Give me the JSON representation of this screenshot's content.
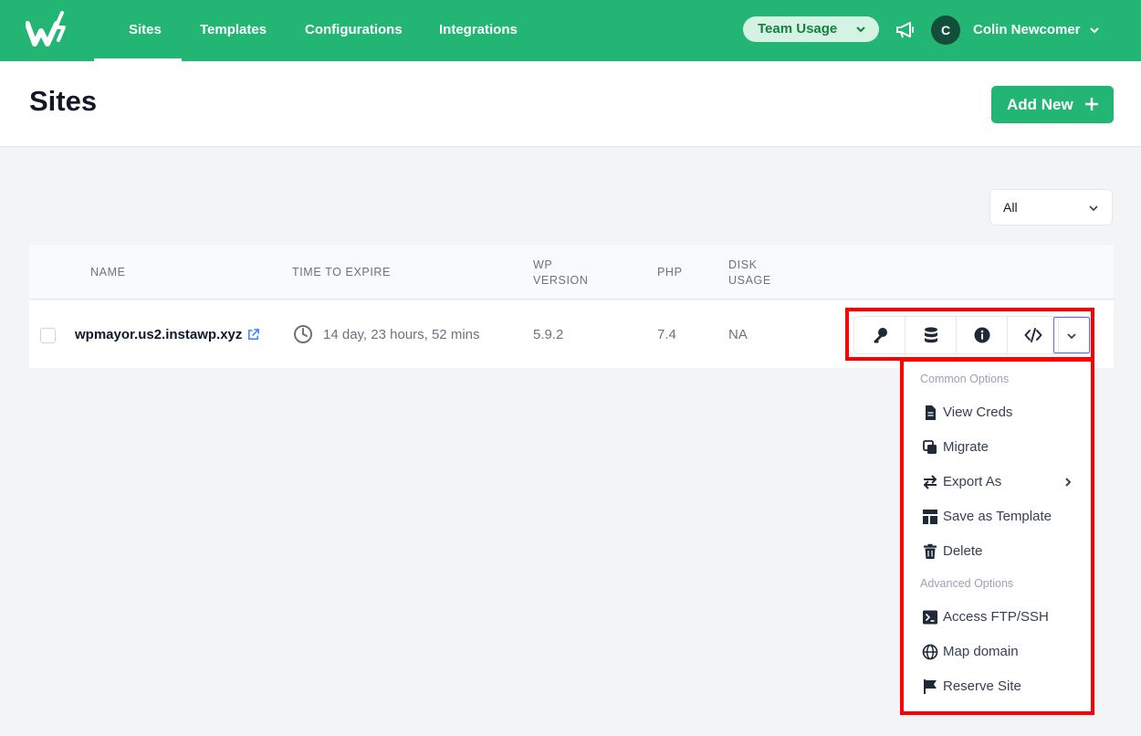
{
  "nav": {
    "tabs": [
      {
        "label": "Sites",
        "active": true
      },
      {
        "label": "Templates"
      },
      {
        "label": "Configurations"
      },
      {
        "label": "Integrations"
      }
    ],
    "team_usage": "Team Usage",
    "avatar_initial": "C",
    "user_name": "Colin Newcomer"
  },
  "header": {
    "title": "Sites",
    "add_new_label": "Add New"
  },
  "filter": {
    "selected": "All"
  },
  "table": {
    "headers": {
      "name": "NAME",
      "time_to_expire": "TIME TO EXPIRE",
      "wp_version_1": "WP",
      "wp_version_2": "VERSION",
      "php": "PHP",
      "disk_usage_1": "DISK",
      "disk_usage_2": "USAGE"
    },
    "rows": [
      {
        "name": "wpmayor.us2.instawp.xyz",
        "time_to_expire": "14 day, 23 hours, 52 mins",
        "wp_version": "5.9.2",
        "php": "7.4",
        "disk_usage": "NA"
      }
    ]
  },
  "actions": [
    "key-icon",
    "database-icon",
    "info-icon",
    "code-icon",
    "chevron-down-icon"
  ],
  "menu": {
    "common_title": "Common Options",
    "common_items": [
      {
        "label": "View Creds",
        "icon": "document-icon"
      },
      {
        "label": "Migrate",
        "icon": "copy-icon"
      },
      {
        "label": "Export As",
        "icon": "swap-icon"
      },
      {
        "label": "Save as Template",
        "icon": "template-icon"
      },
      {
        "label": "Delete",
        "icon": "trash-icon"
      }
    ],
    "advanced_title": "Advanced Options",
    "advanced_items": [
      {
        "label": "Access FTP/SSH",
        "icon": "terminal-icon"
      },
      {
        "label": "Map domain",
        "icon": "globe-icon"
      },
      {
        "label": "Reserve Site",
        "icon": "flag-icon"
      }
    ]
  },
  "colors": {
    "brand": "#22b573",
    "highlight": "#ff0000"
  }
}
